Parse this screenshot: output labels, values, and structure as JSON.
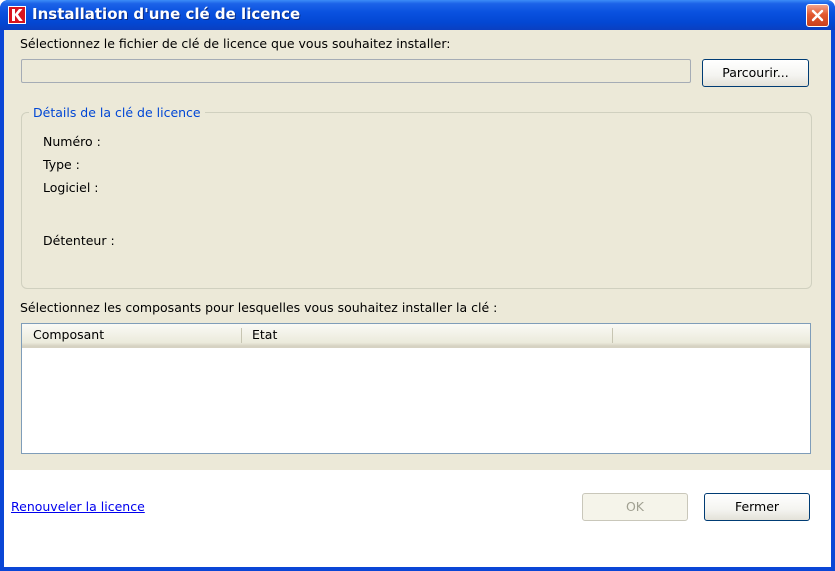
{
  "window": {
    "title": "Installation d'une clé de licence",
    "icon": "kaspersky-logo-icon",
    "close_icon": "close-icon"
  },
  "file_section": {
    "label": "Sélectionnez le fichier de clé de licence que vous souhaitez installer:",
    "input_value": "",
    "browse_label": "Parcourir..."
  },
  "details": {
    "legend": "Détails de la clé de licence",
    "number_label": "Numéro :",
    "type_label": "Type :",
    "software_label": "Logiciel :",
    "owner_label": "Détenteur :"
  },
  "components": {
    "label": "Sélectionnez les composants pour lesquelles vous souhaitez installer la clé :",
    "columns": [
      "Composant",
      "Etat",
      ""
    ]
  },
  "footer": {
    "renew_link": "Renouveler la licence",
    "ok_label": "OK",
    "close_label": "Fermer"
  },
  "colors": {
    "titlebar": "#0a52e0",
    "client_bg": "#ece9d8",
    "legend_text": "#0046d5",
    "link": "#0000ee",
    "close_button": "#e2582f"
  }
}
